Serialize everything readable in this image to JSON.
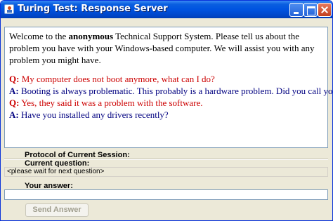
{
  "window": {
    "title": "Turing Test: Response Server",
    "icon": "java-cup-icon"
  },
  "session": {
    "label": "Protocol of Current Session:",
    "intro_before": "Welcome to the ",
    "intro_bold": "anonymous",
    "intro_after": " Technical Support System. Please tell us about the problem you have with your Windows-based computer. We will assist you with any problem you might have.",
    "lines": [
      {
        "tag": "Q:",
        "text": " My computer does not boot anymore, what can I do?"
      },
      {
        "tag": "A:",
        "text": " Booting is always problematic. This probably is a hardware problem. Did you call your vendor?"
      },
      {
        "tag": "Q:",
        "text": " Yes, they said it was a problem with the software."
      },
      {
        "tag": "A:",
        "text": " Have you installed any drivers recently?"
      }
    ]
  },
  "current_question": {
    "label": "Current question:",
    "value": "<please wait for next question>"
  },
  "answer": {
    "label": "Your answer:",
    "value": ""
  },
  "send_button": {
    "label": "Send Answer",
    "enabled": false
  },
  "colors": {
    "question": "#cc0000",
    "answer": "#000080",
    "titlebar": "#0053e0"
  }
}
